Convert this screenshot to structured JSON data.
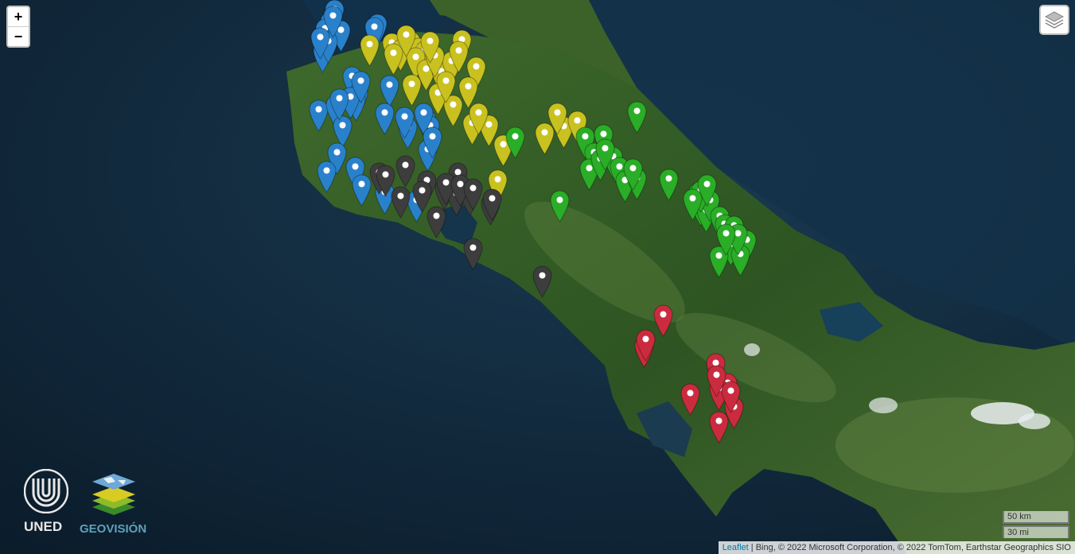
{
  "controls": {
    "zoom_in": "+",
    "zoom_out": "−",
    "layers_icon": "layers-icon"
  },
  "logos": {
    "uned": "UNED",
    "geovision": "GEOVISIÓN"
  },
  "scale": {
    "km": "50 km",
    "mi": "30 mi"
  },
  "attribution": {
    "link": "Leaflet",
    "text": " | Bing, © 2022 Microsoft Corporation, © 2022 TomTom, Earthstar Geographics SIO"
  },
  "marker_colors": {
    "blue": "#2a81cb",
    "yellow": "#c9c11f",
    "green": "#2aad27",
    "gray": "#3d3d3d",
    "red": "#cb2b3e"
  },
  "marker_groups": {
    "blue": 34,
    "yellow": 31,
    "green": 32,
    "gray": 18,
    "red": 11
  }
}
